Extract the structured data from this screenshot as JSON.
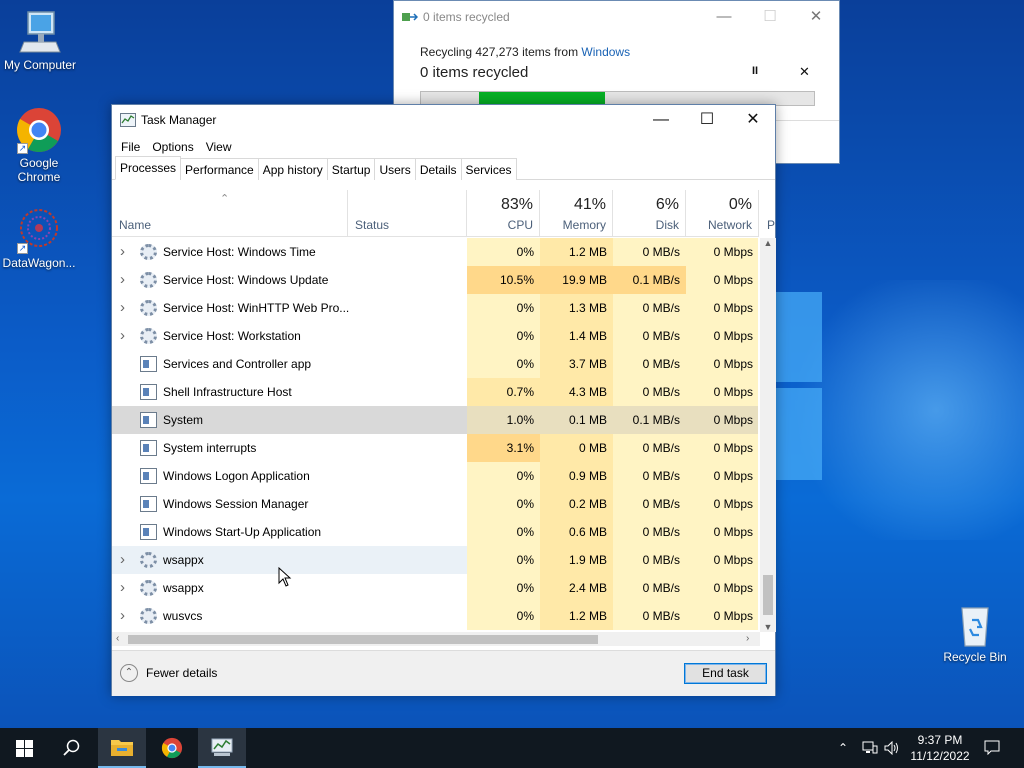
{
  "desktop": {
    "icons": [
      {
        "label": "My Computer",
        "icon": "computer-icon"
      },
      {
        "label": "Google Chrome",
        "icon": "chrome-icon"
      },
      {
        "label": "DataWagon...",
        "icon": "datawagon-icon"
      },
      {
        "label": "Recycle Bin",
        "icon": "recycle-bin-icon"
      }
    ]
  },
  "recycle_window": {
    "title": "0 items recycled",
    "line1_prefix": "Recycling 427,273 items from",
    "line1_link": "Windows",
    "status": "0 items recycled",
    "pause_glyph": "II",
    "close_glyph": "✕",
    "progress_fraction": 0.32,
    "progress_color": "#06b025"
  },
  "task_manager": {
    "title": "Task Manager",
    "menu": [
      "File",
      "Options",
      "View"
    ],
    "tabs": [
      "Processes",
      "Performance",
      "App history",
      "Startup",
      "Users",
      "Details",
      "Services"
    ],
    "active_tab": "Processes",
    "columns": {
      "name": "Name",
      "status": "Status",
      "cpu": {
        "pct": "83%",
        "label": "CPU"
      },
      "memory": {
        "pct": "41%",
        "label": "Memory"
      },
      "disk": {
        "pct": "6%",
        "label": "Disk"
      },
      "network": {
        "pct": "0%",
        "label": "Network"
      },
      "overflow": "P"
    },
    "rows": [
      {
        "name": "Service Host: Windows Time",
        "expandable": true,
        "icon": "gear-icon",
        "cpu": "0%",
        "mem": "1.2 MB",
        "disk": "0 MB/s",
        "net": "0 Mbps"
      },
      {
        "name": "Service Host: Windows Update",
        "expandable": true,
        "icon": "gear-icon",
        "cpu": "10.5%",
        "mem": "19.9 MB",
        "disk": "0.1 MB/s",
        "net": "0 Mbps"
      },
      {
        "name": "Service Host: WinHTTP Web Pro...",
        "expandable": true,
        "icon": "gear-icon",
        "cpu": "0%",
        "mem": "1.3 MB",
        "disk": "0 MB/s",
        "net": "0 Mbps"
      },
      {
        "name": "Service Host: Workstation",
        "expandable": true,
        "icon": "gear-icon",
        "cpu": "0%",
        "mem": "1.4 MB",
        "disk": "0 MB/s",
        "net": "0 Mbps"
      },
      {
        "name": "Services and Controller app",
        "expandable": false,
        "icon": "app-window-icon",
        "cpu": "0%",
        "mem": "3.7 MB",
        "disk": "0 MB/s",
        "net": "0 Mbps"
      },
      {
        "name": "Shell Infrastructure Host",
        "expandable": false,
        "icon": "app-window-icon",
        "cpu": "0.7%",
        "mem": "4.3 MB",
        "disk": "0 MB/s",
        "net": "0 Mbps"
      },
      {
        "name": "System",
        "expandable": false,
        "icon": "app-window-icon",
        "cpu": "1.0%",
        "mem": "0.1 MB",
        "disk": "0.1 MB/s",
        "net": "0 Mbps",
        "selected": true
      },
      {
        "name": "System interrupts",
        "expandable": false,
        "icon": "app-window-icon",
        "cpu": "3.1%",
        "mem": "0 MB",
        "disk": "0 MB/s",
        "net": "0 Mbps"
      },
      {
        "name": "Windows Logon Application",
        "expandable": false,
        "icon": "app-window-icon",
        "cpu": "0%",
        "mem": "0.9 MB",
        "disk": "0 MB/s",
        "net": "0 Mbps"
      },
      {
        "name": "Windows Session Manager",
        "expandable": false,
        "icon": "app-window-icon",
        "cpu": "0%",
        "mem": "0.2 MB",
        "disk": "0 MB/s",
        "net": "0 Mbps"
      },
      {
        "name": "Windows Start-Up Application",
        "expandable": false,
        "icon": "app-window-icon",
        "cpu": "0%",
        "mem": "0.6 MB",
        "disk": "0 MB/s",
        "net": "0 Mbps"
      },
      {
        "name": "wsappx",
        "expandable": true,
        "icon": "gear-icon",
        "cpu": "0%",
        "mem": "1.9 MB",
        "disk": "0 MB/s",
        "net": "0 Mbps",
        "hovered": true
      },
      {
        "name": "wsappx",
        "expandable": true,
        "icon": "gear-icon",
        "cpu": "0%",
        "mem": "2.4 MB",
        "disk": "0 MB/s",
        "net": "0 Mbps"
      },
      {
        "name": "wusvcs",
        "expandable": true,
        "icon": "gear-icon",
        "cpu": "0%",
        "mem": "1.2 MB",
        "disk": "0 MB/s",
        "net": "0 Mbps"
      }
    ],
    "footer": {
      "fewer_details": "Fewer details",
      "end_task": "End task"
    },
    "heat_colors": {
      "low": "#fff4c4",
      "mid": "#ffe9a8",
      "high": "#ffd88a"
    }
  },
  "taskbar": {
    "time": "9:37 PM",
    "date": "11/12/2022",
    "items": [
      "start-icon",
      "search-icon",
      "file-explorer-icon",
      "chrome-icon",
      "task-manager-icon"
    ]
  }
}
